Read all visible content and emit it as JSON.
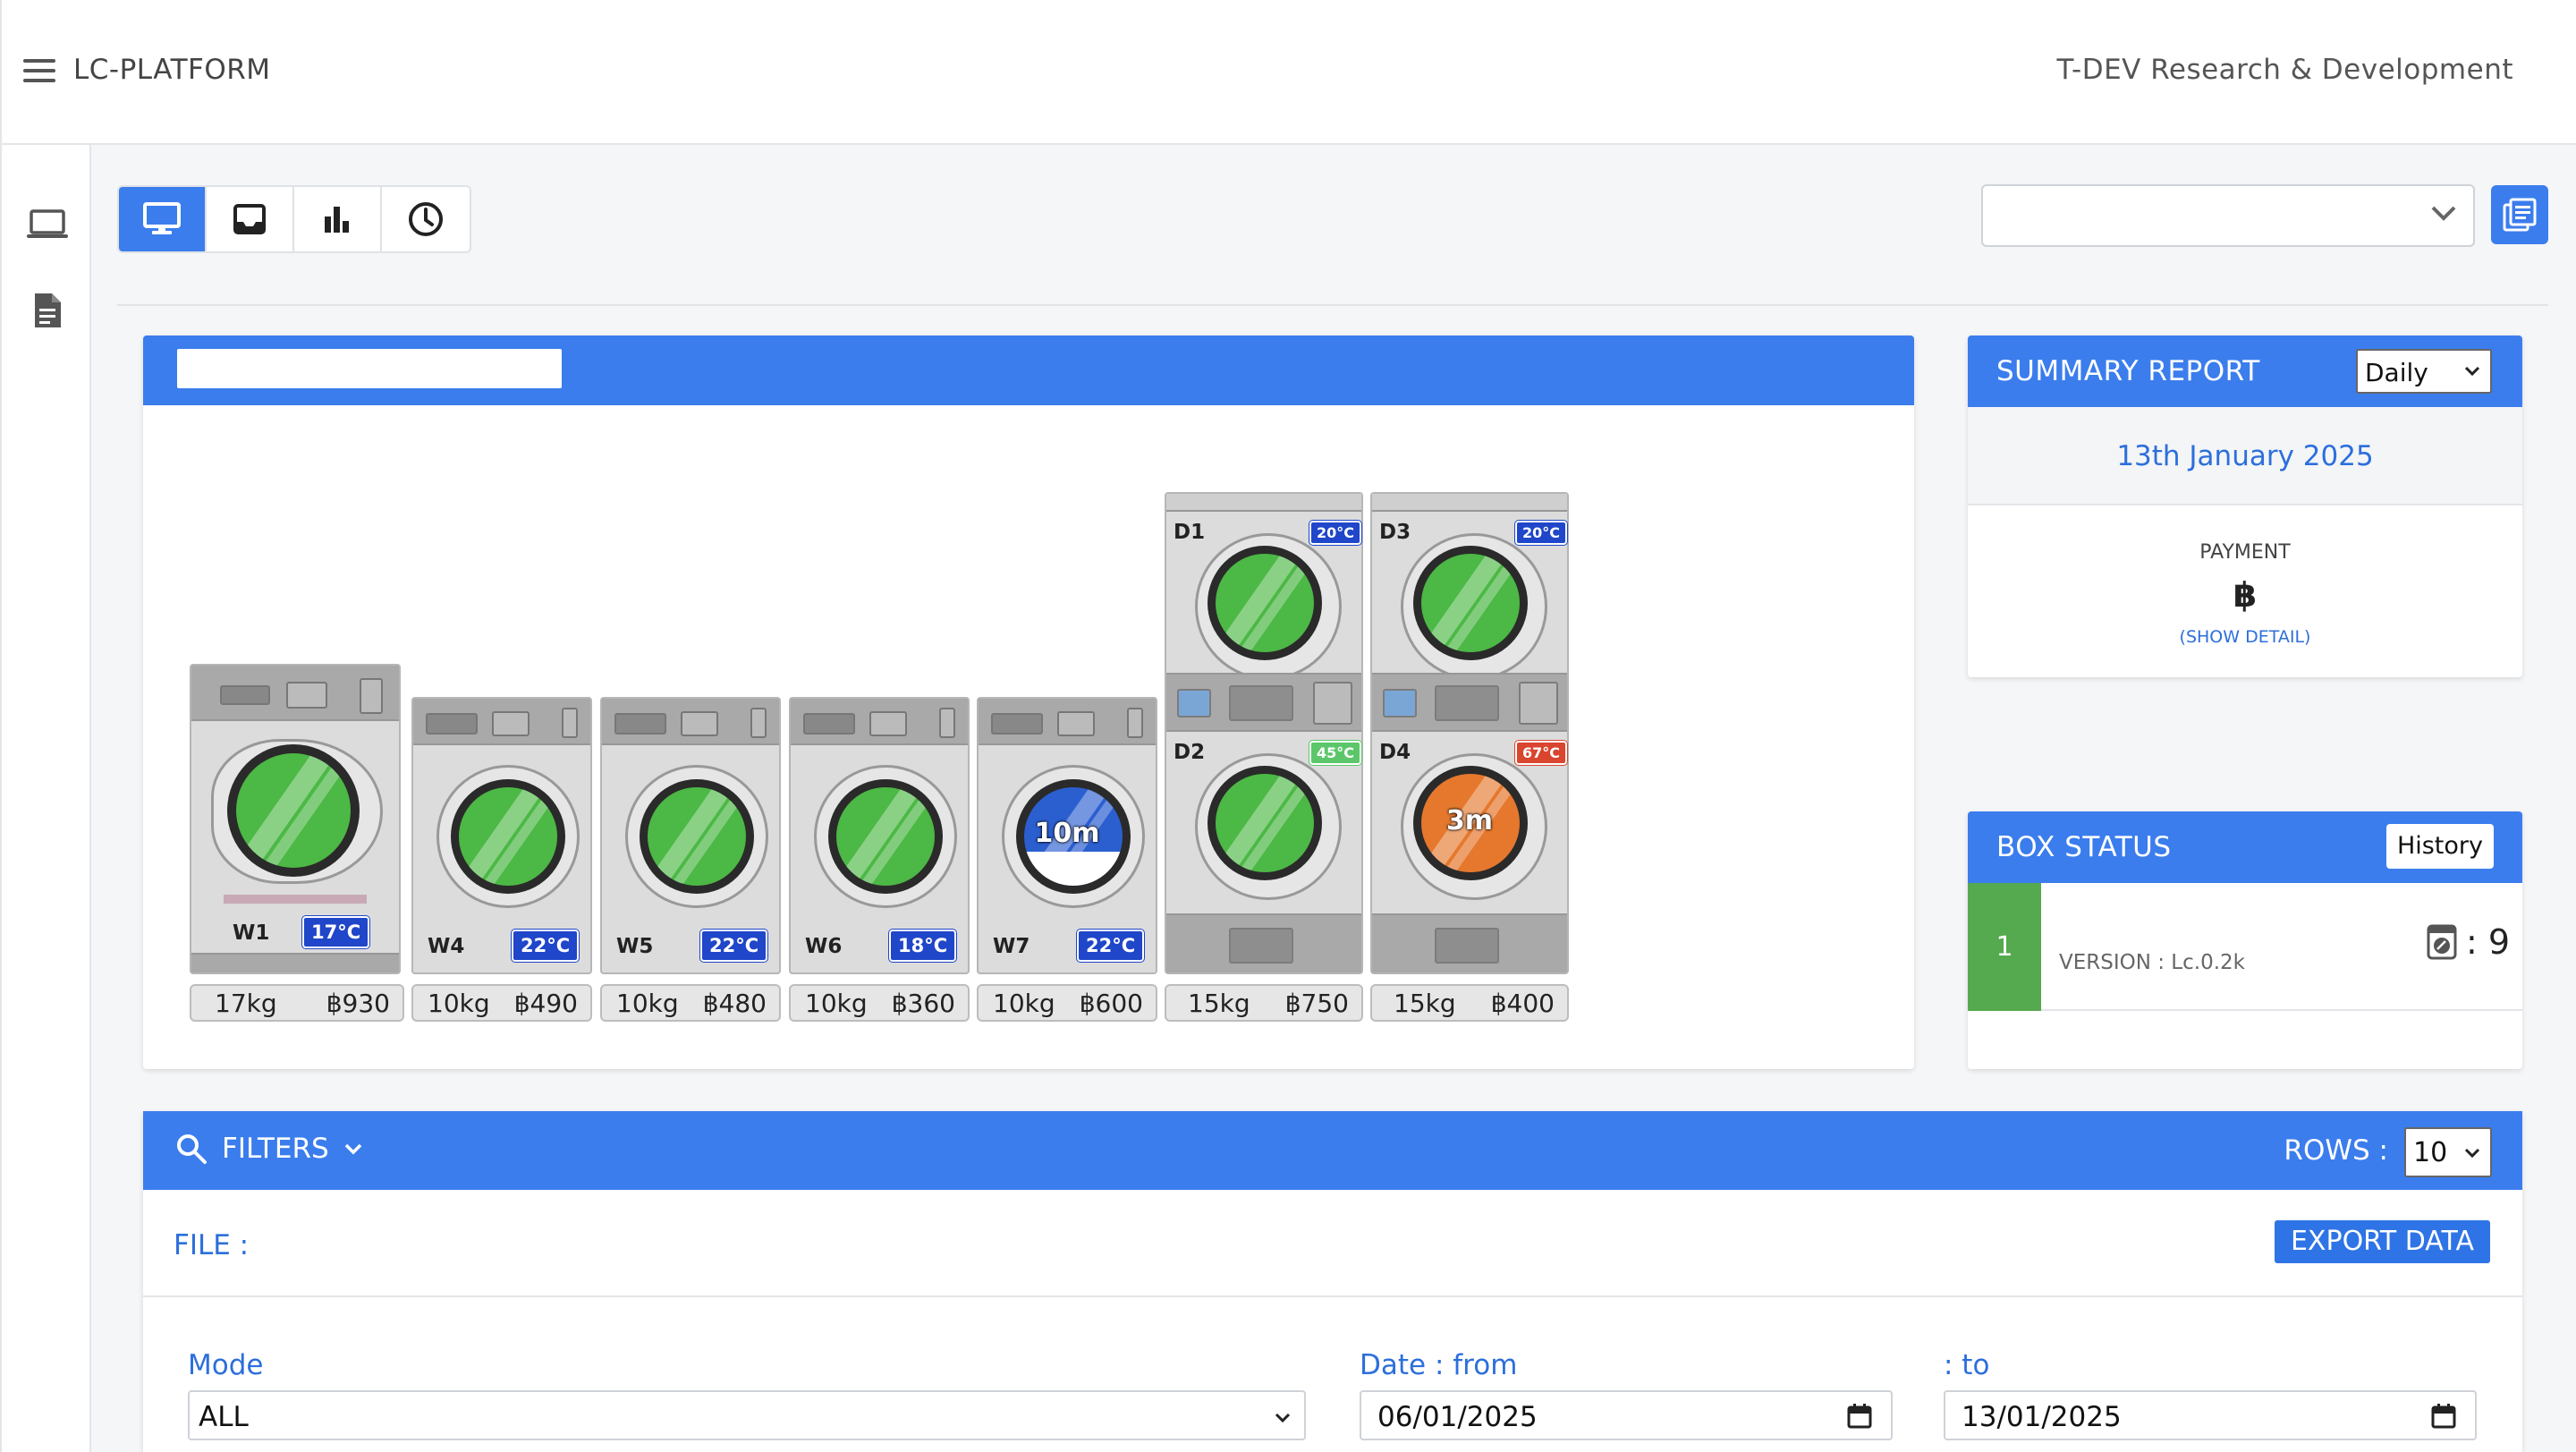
{
  "app": {
    "title": "LC-PLATFORM",
    "company": "T-DEV Research & Development"
  },
  "icons": {
    "menu": "menu-icon",
    "sidebar": [
      "laptop-icon",
      "document-icon"
    ],
    "view_tabs": [
      "monitor-icon",
      "inbox-icon",
      "bar-chart-icon",
      "clock-icon"
    ],
    "list": "list-icon"
  },
  "colors": {
    "primary": "#3b7ded",
    "status_green": "#55a94f",
    "temp_blue": "#2046c9",
    "temp_green": "#5cc76a",
    "temp_red": "#d9452e"
  },
  "top_select": {
    "value": ""
  },
  "machines": {
    "washers": [
      {
        "name": "W1",
        "temp": "17°C",
        "weight": "17kg",
        "price": "฿930",
        "state": "idle"
      },
      {
        "name": "W4",
        "temp": "22°C",
        "weight": "10kg",
        "price": "฿490",
        "state": "idle"
      },
      {
        "name": "W5",
        "temp": "22°C",
        "weight": "10kg",
        "price": "฿480",
        "state": "idle"
      },
      {
        "name": "W6",
        "temp": "18°C",
        "weight": "10kg",
        "price": "฿360",
        "state": "idle"
      },
      {
        "name": "W7",
        "temp": "22°C",
        "weight": "10kg",
        "price": "฿600",
        "state": "running",
        "time": "10m"
      }
    ],
    "dryers": [
      {
        "top_name": "D1",
        "top_temp": "20°C",
        "bottom_name": "D2",
        "bottom_temp": "45°C",
        "weight": "15kg",
        "price": "฿750"
      },
      {
        "top_name": "D3",
        "top_temp": "20°C",
        "bottom_name": "D4",
        "bottom_temp": "67°C",
        "bottom_time": "3m",
        "weight": "15kg",
        "price": "฿400"
      }
    ]
  },
  "summary": {
    "title": "SUMMARY REPORT",
    "period": "Daily",
    "date": "13th January 2025",
    "payment_label": "PAYMENT",
    "payment_value": "฿",
    "show_detail": "(SHOW DETAIL)"
  },
  "box_status": {
    "title": "BOX STATUS",
    "history": "History",
    "rows": [
      {
        "number": "1",
        "version": "VERSION : Lc.0.2k",
        "count": ": 9"
      }
    ]
  },
  "filters": {
    "toggle": "FILTERS",
    "rows_label": "ROWS :",
    "rows_value": "10",
    "file_label": "FILE :",
    "export": "EXPORT DATA",
    "mode_label": "Mode",
    "mode_value": "ALL",
    "from_label": "Date : from",
    "from_value": "06/01/2025",
    "to_label": ": to",
    "to_value": "13/01/2025"
  }
}
